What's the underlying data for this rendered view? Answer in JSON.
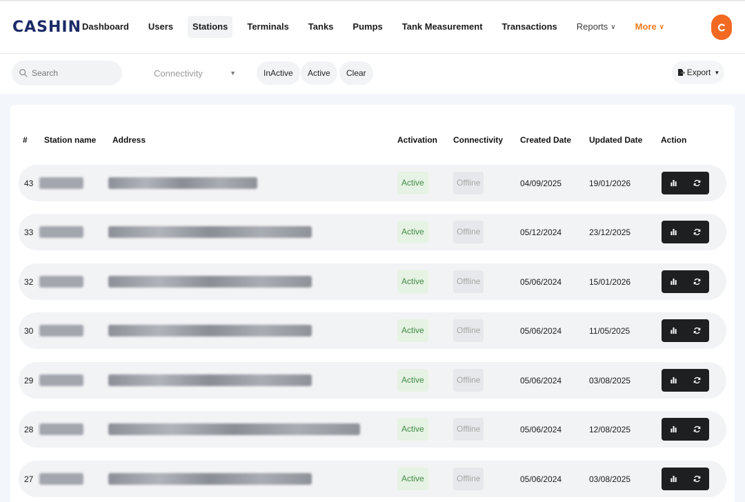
{
  "app": {
    "logo": "CASHIN"
  },
  "nav": {
    "items": [
      {
        "label": "Dashboard"
      },
      {
        "label": "Users"
      },
      {
        "label": "Stations",
        "active": true
      },
      {
        "label": "Terminals"
      },
      {
        "label": "Tanks"
      },
      {
        "label": "Pumps"
      },
      {
        "label": "Tank Measurement"
      },
      {
        "label": "Transactions"
      }
    ],
    "reports_label": "Reports",
    "more_label": "More",
    "more_color": "#f07a1c",
    "avatar_color": "#f26a21"
  },
  "filters": {
    "search_placeholder": "Search",
    "connectivity_label": "Connectivity",
    "inactive_label": "InActive",
    "active_label": "Active",
    "clear_label": "Clear",
    "export_label": "Export"
  },
  "table": {
    "columns": [
      "#",
      "Station name",
      "Address",
      "Activation",
      "Connectivity",
      "Created Date",
      "Updated Date",
      "Action"
    ],
    "rows": [
      {
        "id": "43",
        "activation": "Active",
        "connectivity": "Offline",
        "created": "04/09/2025",
        "updated": "19/01/2026"
      },
      {
        "id": "33",
        "activation": "Active",
        "connectivity": "Offline",
        "created": "05/12/2024",
        "updated": "23/12/2025"
      },
      {
        "id": "32",
        "activation": "Active",
        "connectivity": "Offline",
        "created": "05/06/2024",
        "updated": "15/01/2026"
      },
      {
        "id": "30",
        "activation": "Active",
        "connectivity": "Offline",
        "created": "05/06/2024",
        "updated": "11/05/2025"
      },
      {
        "id": "29",
        "activation": "Active",
        "connectivity": "Offline",
        "created": "05/06/2024",
        "updated": "03/08/2025"
      },
      {
        "id": "28",
        "activation": "Active",
        "connectivity": "Offline",
        "created": "05/06/2024",
        "updated": "12/08/2025"
      },
      {
        "id": "27",
        "activation": "Active",
        "connectivity": "Offline",
        "created": "05/06/2024",
        "updated": "03/08/2025"
      }
    ]
  },
  "colors": {
    "brand": "#1c2a68",
    "active_text": "#3f8a46",
    "active_bg": "#e6f2e3",
    "offline_bg": "#e7e8eb",
    "action_bg": "#1e1f21"
  },
  "icons": [
    "search-icon",
    "chevron-down-icon",
    "export-icon",
    "bar-chart-icon",
    "refresh-icon",
    "user-avatar-icon"
  ]
}
